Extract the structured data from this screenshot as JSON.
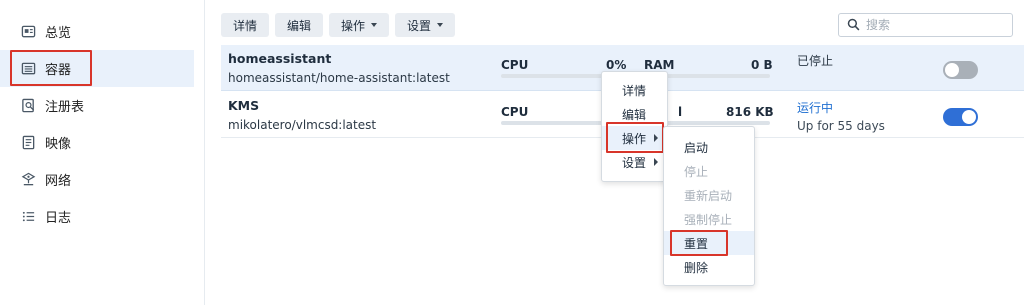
{
  "sidebar": {
    "items": [
      {
        "label": "总览",
        "icon": "overview-icon"
      },
      {
        "label": "容器",
        "icon": "container-icon"
      },
      {
        "label": "注册表",
        "icon": "registry-icon"
      },
      {
        "label": "映像",
        "icon": "image-icon"
      },
      {
        "label": "网络",
        "icon": "network-icon"
      },
      {
        "label": "日志",
        "icon": "log-icon"
      }
    ],
    "active_index": 1
  },
  "toolbar": {
    "details": "详情",
    "edit": "编辑",
    "action": "操作",
    "settings": "设置"
  },
  "search": {
    "placeholder": "搜索",
    "value": ""
  },
  "containers": [
    {
      "name": "homeassistant",
      "image": "homeassistant/home-assistant:latest",
      "cpu_label": "CPU",
      "cpu_value": "0%",
      "ram_label": "RAM",
      "ram_value": "0 B",
      "status": "已停止",
      "uptime": "",
      "enabled": false
    },
    {
      "name": "KMS",
      "image": "mikolatero/vlmcsd:latest",
      "cpu_label": "CPU",
      "cpu_value": "",
      "ram_label": "l",
      "ram_value": "816 KB",
      "status": "运行中",
      "uptime": "Up for 55 days",
      "enabled": true
    }
  ],
  "context_menu": {
    "items": [
      "详情",
      "编辑",
      "操作",
      "设置"
    ]
  },
  "action_submenu": {
    "items": [
      {
        "label": "启动",
        "disabled": false
      },
      {
        "label": "停止",
        "disabled": true
      },
      {
        "label": "重新启动",
        "disabled": true
      },
      {
        "label": "强制停止",
        "disabled": true
      },
      {
        "label": "重置",
        "disabled": false
      },
      {
        "label": "删除",
        "disabled": false
      }
    ]
  },
  "colors": {
    "accent": "#2f6fd6",
    "selection": "#e9f1fb",
    "highlight_box": "#d8352a",
    "running": "#1f6fd1"
  }
}
